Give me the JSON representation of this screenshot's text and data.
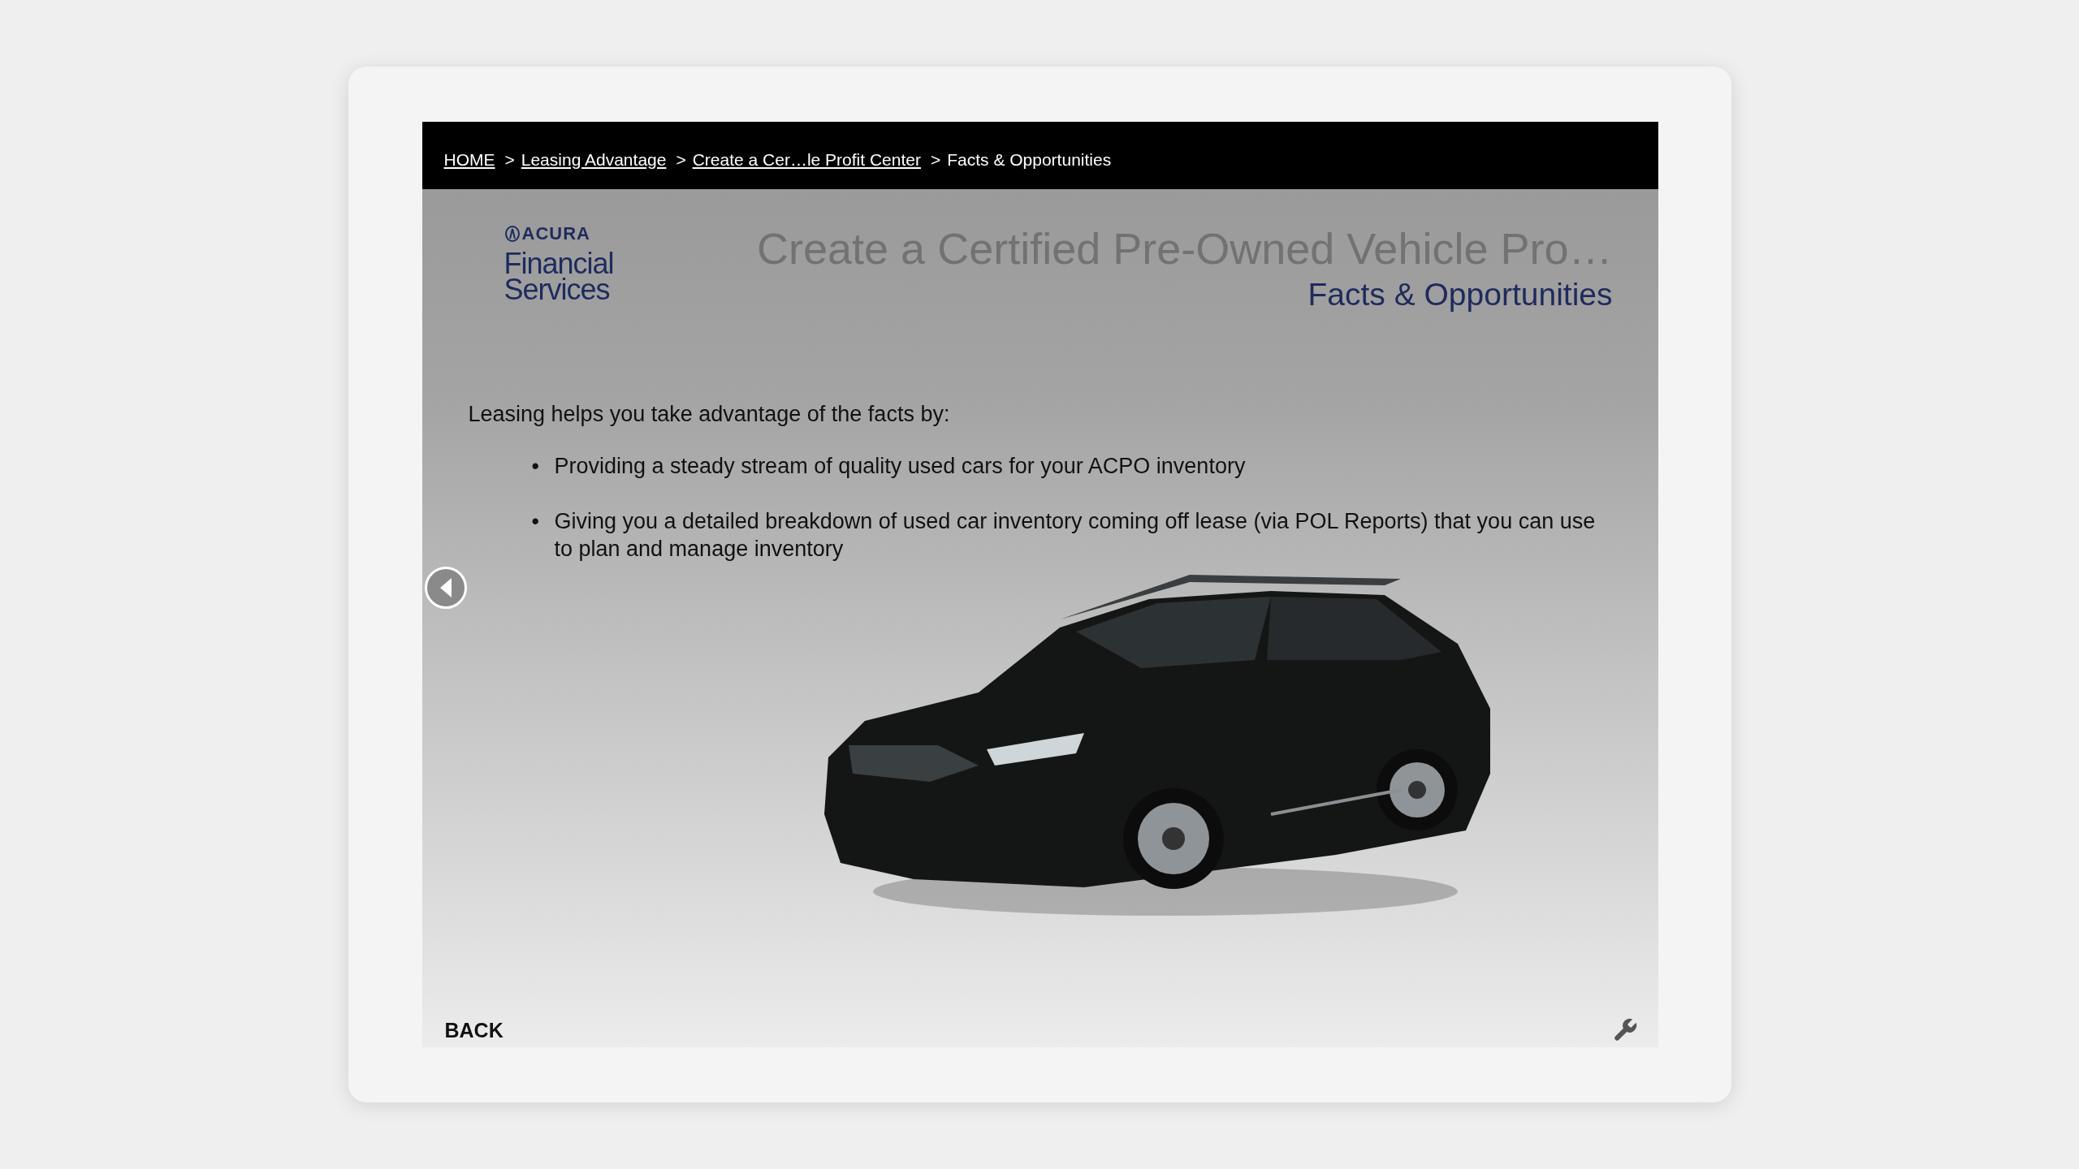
{
  "breadcrumb": [
    {
      "label": "HOME",
      "kind": "link"
    },
    {
      "prefix": ">",
      "label": "Leasing Advantage",
      "kind": "link"
    },
    {
      "prefix": ">",
      "label": "Create a Cer…le Profit Center",
      "kind": "link"
    },
    {
      "prefix": ">",
      "label": "Facts & Opportunities",
      "kind": "current"
    }
  ],
  "logo": {
    "brand": "ACURA",
    "line1": "Financial",
    "line2": "Services"
  },
  "title": "Create a Certified Pre-Owned Vehicle Pro…",
  "subtitle": "Facts & Opportunities",
  "intro": "Leasing helps you take advantage of the facts by:",
  "bullets": [
    {
      "marker": "•",
      "text": "Providing a steady stream of quality used cars for your ACPO inventory"
    },
    {
      "marker": "•",
      "text": "Giving you a detailed breakdown of used car inventory coming off lease (via POL Reports) that you can use to plan and manage inventory"
    }
  ],
  "footer": {
    "back": "BACK"
  }
}
